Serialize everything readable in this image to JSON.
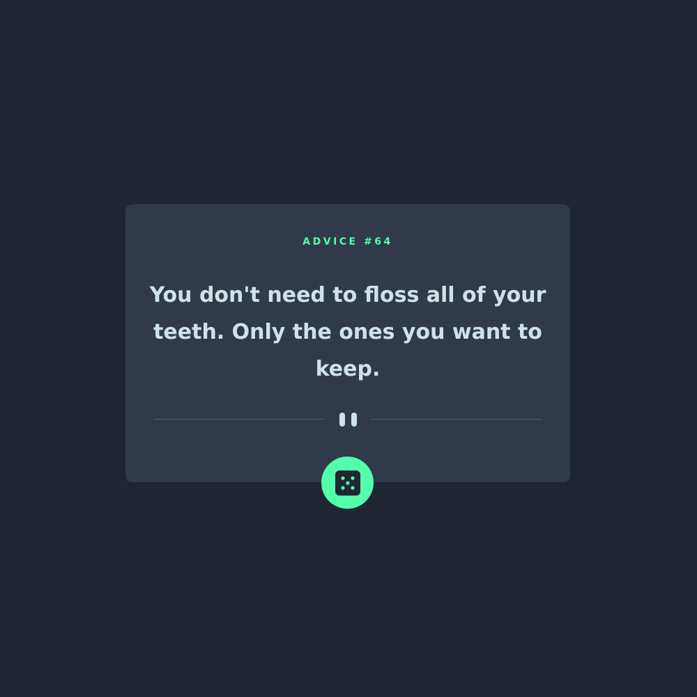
{
  "advice": {
    "label": "ADVICE #64",
    "quote": "You don't need to floss all of your teeth. Only the ones you want to keep."
  },
  "divider": {
    "icon": "pause-icon"
  },
  "dice_button": {
    "icon": "dice-icon"
  },
  "colors": {
    "background": "#1f2631",
    "card": "#313a49",
    "accent": "#53ffaa",
    "text": "#cee3e9",
    "divider": "#4f5d74"
  }
}
